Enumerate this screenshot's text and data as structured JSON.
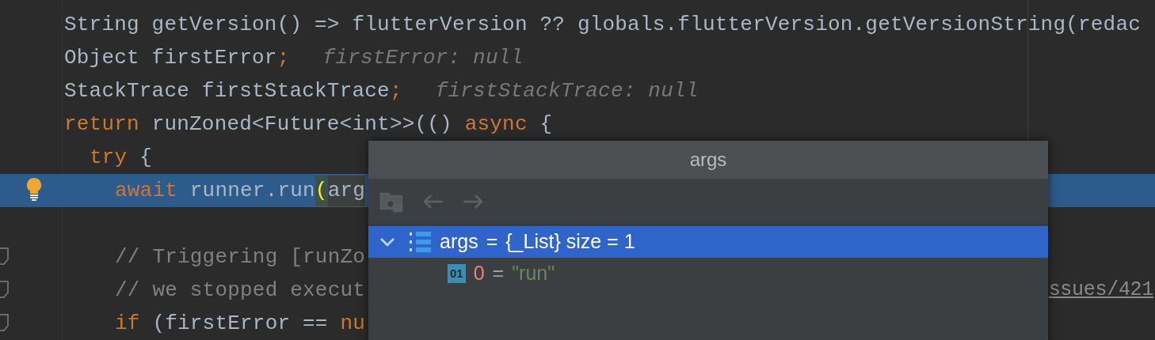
{
  "editor": {
    "lines": [
      {
        "current": false,
        "segments": [
          {
            "kind": "plain",
            "text": "String getVersion() => flutterVersion ?? globals.flutterVersion.getVersionString(redac"
          }
        ]
      },
      {
        "current": false,
        "segments": [
          {
            "kind": "plain",
            "text": "Object firstError"
          },
          {
            "kind": "punct",
            "text": ";"
          },
          {
            "kind": "hint",
            "text": "firstError: null"
          }
        ]
      },
      {
        "current": false,
        "segments": [
          {
            "kind": "plain",
            "text": "StackTrace firstStackTrace"
          },
          {
            "kind": "punct",
            "text": ";"
          },
          {
            "kind": "hint",
            "text": "firstStackTrace: null"
          }
        ]
      },
      {
        "current": false,
        "segments": [
          {
            "kind": "keyword",
            "text": "return"
          },
          {
            "kind": "plain",
            "text": " runZoned<Future<int>>(() "
          },
          {
            "kind": "keyword",
            "text": "async"
          },
          {
            "kind": "plain",
            "text": " {"
          }
        ],
        "children": [
          {
            "current": false,
            "segments": [
              {
                "kind": "keyword",
                "text": "try"
              },
              {
                "kind": "plain",
                "text": " {"
              }
            ],
            "children": [
              {
                "current": true,
                "bulb": true,
                "segments": [
                  {
                    "kind": "keyword",
                    "text": "await"
                  },
                  {
                    "kind": "plain",
                    "text": " runner.run"
                  },
                  {
                    "kind": "brace",
                    "text": "("
                  },
                  {
                    "kind": "hover",
                    "text": "arg"
                  }
                ]
              },
              {
                "current": false
              },
              {
                "current": false,
                "fold": true,
                "segments": [
                  {
                    "kind": "comment",
                    "text": "// Triggering [runZo"
                  }
                ]
              },
              {
                "current": false,
                "fold": true,
                "segments": [
                  {
                    "kind": "comment",
                    "text": "// we stopped execut"
                  }
                ],
                "tail": {
                  "kind": "link",
                  "text": "ssues/421"
                }
              },
              {
                "current": false,
                "fold": true,
                "segments": [
                  {
                    "kind": "keyword",
                    "text": "if"
                  },
                  {
                    "kind": "plain",
                    "text": " (firstError == "
                  },
                  {
                    "kind": "keyword",
                    "text": "nu"
                  }
                ]
              }
            ]
          }
        ]
      }
    ]
  },
  "popup": {
    "title": "args",
    "tree": [
      {
        "name": "args",
        "separator": "=",
        "value": "{_List} size = 1",
        "selected": true,
        "expanded": true,
        "children": [
          {
            "badge": "01",
            "name": "0",
            "separator": "=",
            "value": "\"run\"",
            "selected": false
          }
        ]
      }
    ]
  }
}
